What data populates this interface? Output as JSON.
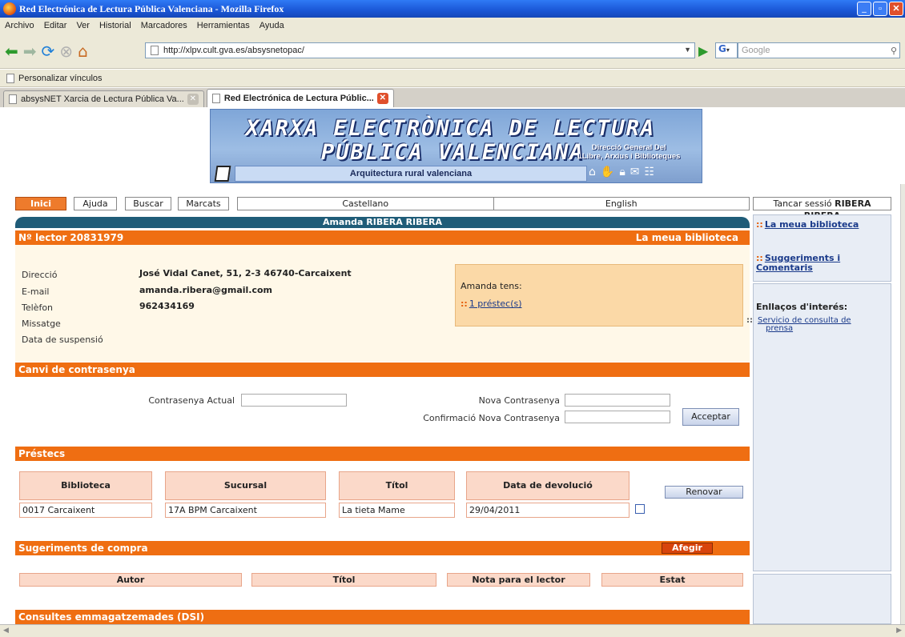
{
  "window": {
    "title": "Red Electrónica de Lectura Pública Valenciana - Mozilla Firefox",
    "controls": [
      "_",
      "▫",
      "✕"
    ]
  },
  "menu": [
    "Archivo",
    "Editar",
    "Ver",
    "Historial",
    "Marcadores",
    "Herramientas",
    "Ayuda"
  ],
  "nav": {
    "url": "http://xlpv.cult.gva.es/absysnetopac/",
    "search_placeholder": "Google",
    "search_engine": "G"
  },
  "bookmarks": {
    "item": "Personalizar vínculos"
  },
  "tabs": [
    {
      "label": "absysNET Xarcia de Lectura Pública Va..."
    },
    {
      "label": "Red Electrónica de Lectura Públic..."
    }
  ],
  "banner": {
    "line1": "XARXA ELECTRÒNICA DE LECTURA",
    "line2": "PÚBLICA VALENCIANA",
    "dg_line1": "Direcció General Del",
    "dg_line2": "LLibre, Arxius i Biblioteques",
    "strip": "Arquitectura rural valenciana"
  },
  "topnav": {
    "inici": "Inici",
    "ajuda": "Ajuda",
    "buscar": "Buscar",
    "marcats": "Marcats",
    "castellano": "Castellano",
    "english": "English",
    "logout_prefix": "Tancar sessió",
    "logout_user": "RIBERA RIBERA"
  },
  "user": {
    "name": "Amanda RIBERA RIBERA",
    "reader_no": "Nº lector 20831979",
    "my_library": "La meua biblioteca",
    "fields": [
      {
        "label": "Direcció",
        "value": "José Vidal Canet, 51, 2-3 46740-Carcaixent"
      },
      {
        "label": "E-mail",
        "value": "amanda.ribera@gmail.com"
      },
      {
        "label": "Telèfon",
        "value": "962434169"
      },
      {
        "label": "Missatge",
        "value": ""
      },
      {
        "label": "Data de suspensió",
        "value": ""
      }
    ],
    "loan_box_text": "Amanda tens:",
    "loan_box_link": "1 préstec(s)"
  },
  "password": {
    "title": "Canvi de contrasenya",
    "current": "Contrasenya Actual",
    "new": "Nova Contrasenya",
    "confirm": "Confirmació Nova Contrasenya",
    "accept": "Acceptar"
  },
  "loans": {
    "title": "Préstecs",
    "renew": "Renovar",
    "headers": [
      "Biblioteca",
      "Sucursal",
      "Títol",
      "Data de devolució"
    ],
    "rows": [
      {
        "biblioteca": "0017 Carcaixent",
        "sucursal": "17A BPM Carcaixent",
        "titol": "La tieta Mame",
        "data": "29/04/2011"
      }
    ]
  },
  "suggestions": {
    "title": "Sugeriments de compra",
    "add": "Afegir",
    "headers": [
      "Autor",
      "Títol",
      "Nota para el lector",
      "Estat"
    ]
  },
  "dsi": {
    "title": "Consultes emmagatzemades (DSI)"
  },
  "sidebar": {
    "my_library": "La meua biblioteca",
    "suggestions": "Suggeriments i Comentaris",
    "links_title": "Enllaços d'interés:",
    "press_link": "Servicio de consulta de prensa"
  },
  "colors": {
    "orange": "#ef6e12",
    "teal": "#1f5c78",
    "cream": "#fff8e8",
    "peach": "#fbd9c9"
  }
}
